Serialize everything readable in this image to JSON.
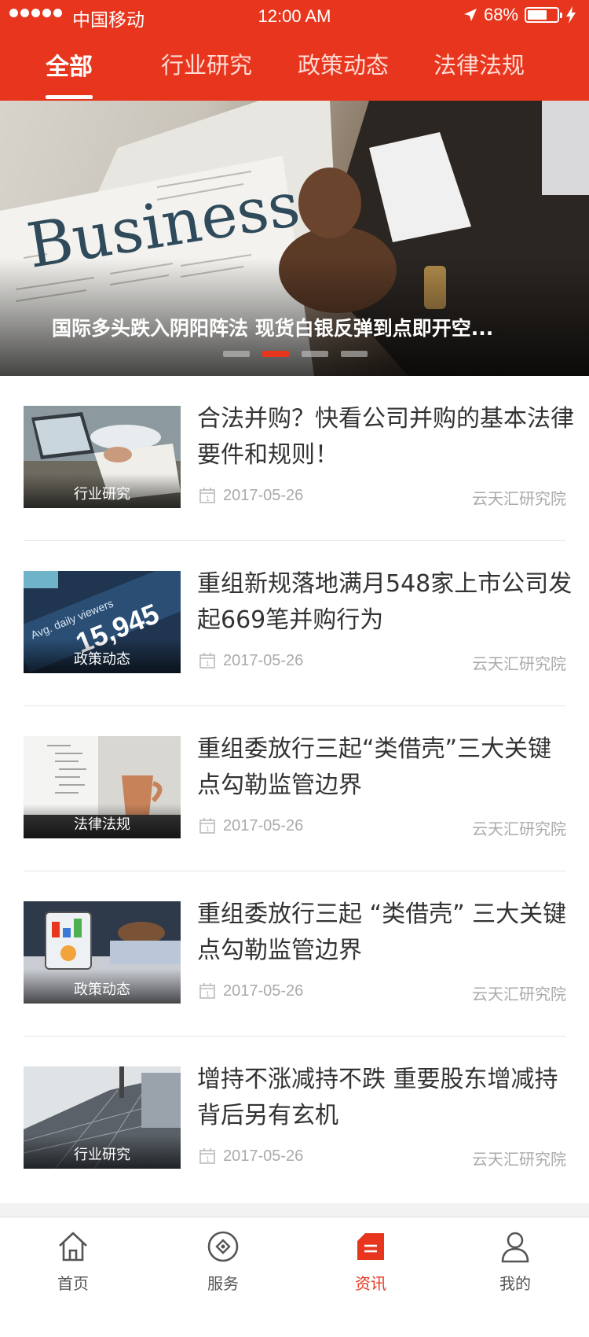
{
  "status_bar": {
    "carrier": "中国移动",
    "time": "12:00 AM",
    "battery_percent": "68%",
    "battery_level": 0.68,
    "icons": [
      "signal-dots-icon",
      "location-arrow-icon",
      "battery-icon",
      "charging-bolt-icon"
    ]
  },
  "tabs": [
    {
      "label": "全部",
      "active": true
    },
    {
      "label": "行业研究",
      "active": false
    },
    {
      "label": "政策动态",
      "active": false
    },
    {
      "label": "法律法规",
      "active": false
    }
  ],
  "banner": {
    "caption": "国际多头跌入阴阳阵法 现货白银反弹到点即开空...",
    "image_text": "Business",
    "slide_count": 4,
    "active_slide": 2
  },
  "articles": [
    {
      "title": "合法并购？快看公司并购的基本法律要件和规则！",
      "category": "行业研究",
      "date": "2017-05-26",
      "source": "云天汇研究院"
    },
    {
      "title": "重组新规落地满月548家上市公司发起669笔并购行为",
      "category": "政策动态",
      "date": "2017-05-26",
      "source": "云天汇研究院",
      "thumb_text": "Avg. daily viewers",
      "thumb_number": "15,945"
    },
    {
      "title": "重组委放行三起“类借壳”三大关键点勾勒监管边界",
      "category": "法律法规",
      "date": "2017-05-26",
      "source": "云天汇研究院"
    },
    {
      "title": "重组委放行三起 “类借壳” 三大关键点勾勒监管边界",
      "category": "政策动态",
      "date": "2017-05-26",
      "source": "云天汇研究院"
    },
    {
      "title": "增持不涨减持不跌 重要股东增减持背后另有玄机",
      "category": "行业研究",
      "date": "2017-05-26",
      "source": "云天汇研究院"
    }
  ],
  "bottom_nav": [
    {
      "label": "首页",
      "icon": "home-icon",
      "active": false
    },
    {
      "label": "服务",
      "icon": "service-icon",
      "active": false
    },
    {
      "label": "资讯",
      "icon": "news-icon",
      "active": true
    },
    {
      "label": "我的",
      "icon": "user-icon",
      "active": false
    }
  ],
  "colors": {
    "brand_red": "#e8361e",
    "text_primary": "#333333",
    "text_meta": "#aaaaaa",
    "divider": "#e6e6e6"
  }
}
